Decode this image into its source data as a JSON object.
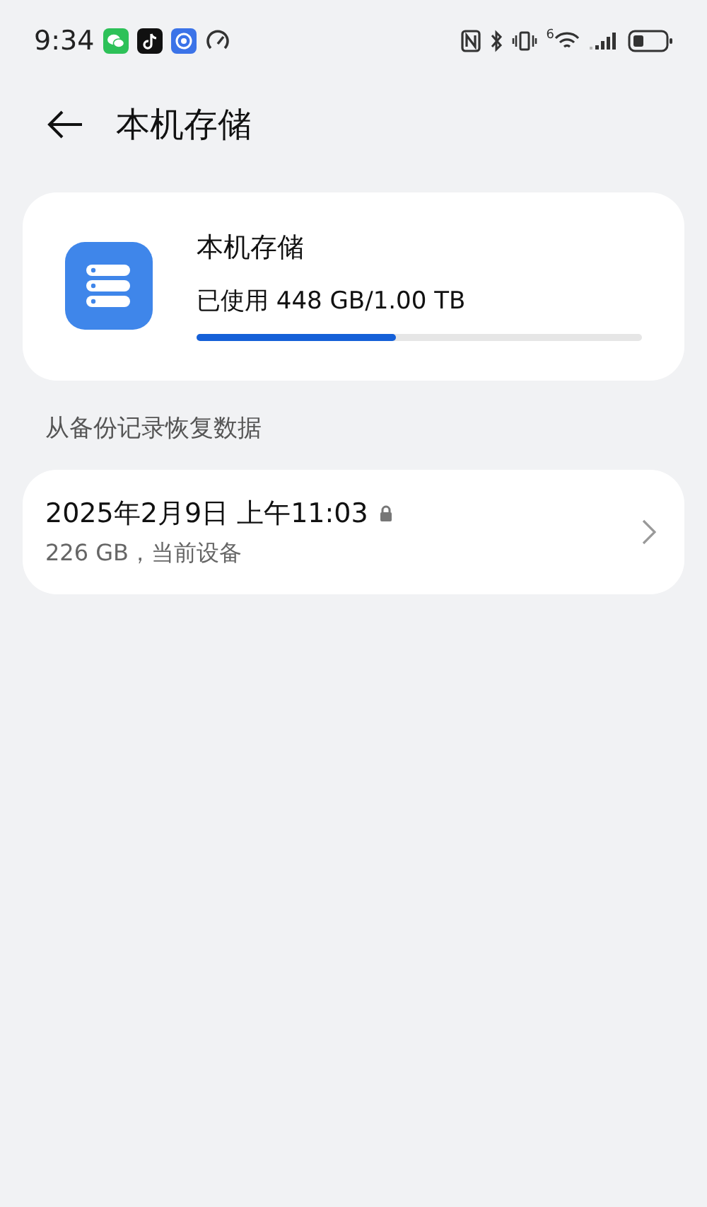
{
  "status_bar": {
    "time": "9:34",
    "wifi_label": "6"
  },
  "header": {
    "title": "本机存储"
  },
  "storage": {
    "title": "本机存储",
    "usage": "已使用 448 GB/1.00 TB",
    "level": 0.448
  },
  "section": {
    "title": "从备份记录恢复数据"
  },
  "backups": [
    {
      "title": "2025年2月9日 上午11:03",
      "locked": true,
      "subtitle": "226 GB，当前设备"
    }
  ]
}
